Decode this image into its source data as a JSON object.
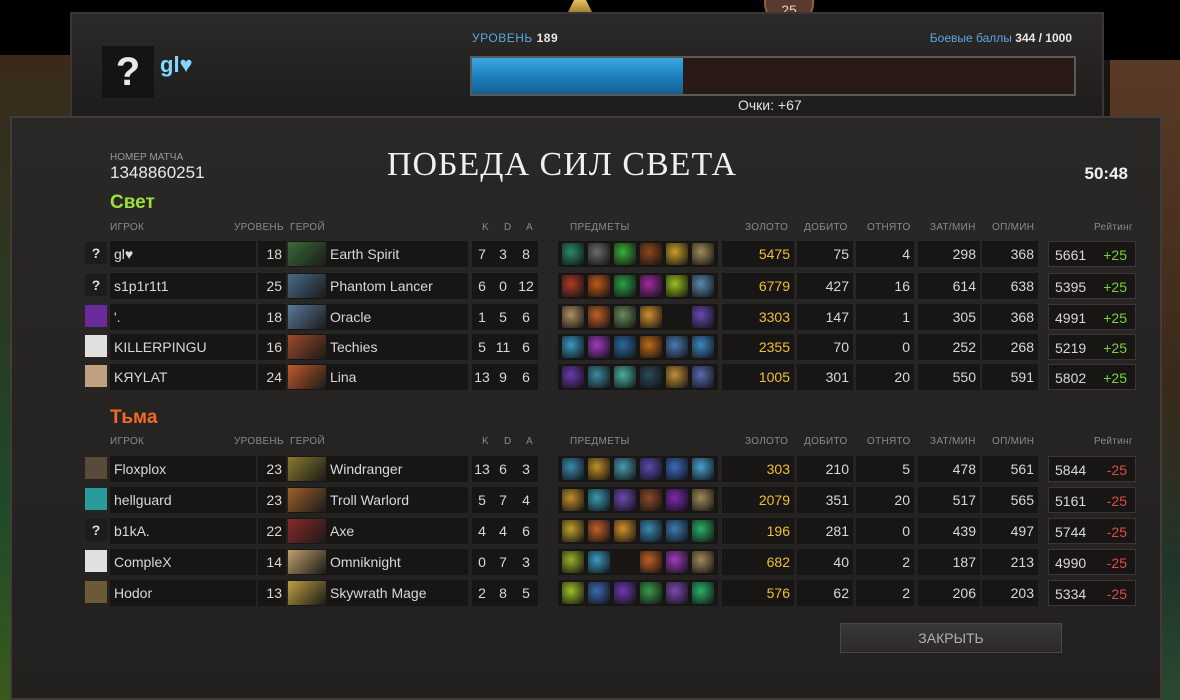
{
  "top_badge": "25",
  "level_panel": {
    "avatar_glyph": "?",
    "player_name": "gl♥",
    "level_label": "УРОВЕНЬ",
    "level_value": "189",
    "battle_label": "Боевые баллы",
    "battle_value": "344 / 1000",
    "xp_progress": 0.35,
    "points": "Очки: +67"
  },
  "match": {
    "label": "НОМЕР МАТЧА",
    "id": "1348860251",
    "title": "ПОБЕДА СИЛ СВЕТА",
    "duration": "50:48"
  },
  "headers": {
    "player": "ИГРОК",
    "level": "УРОВЕНЬ",
    "hero": "ГЕРОЙ",
    "k": "K",
    "d": "D",
    "a": "A",
    "items": "ПРЕДМЕТЫ",
    "gold": "ЗОЛОТО",
    "last_hits": "ДОБИТО",
    "denies": "ОТНЯТО",
    "gpm": "ЗАТ/МИН",
    "xpm": "ОП/МИН",
    "rating": "Рейтинг"
  },
  "radiant": {
    "name": "Свет",
    "players": [
      {
        "avatar": "?",
        "avatar_color": "#1c1c1c",
        "name": "gl♥",
        "level": "18",
        "hero": "Earth Spirit",
        "hero_color": "#3a6a3a",
        "k": "7",
        "d": "3",
        "a": "8",
        "items": [
          "#2a8a6a",
          "#6a6a6a",
          "#3ab03a",
          "#8a4a1a",
          "#c8a02a",
          "#a08a5a"
        ],
        "gold": "5475",
        "lh": "75",
        "dn": "4",
        "gpm": "298",
        "xpm": "368",
        "rating": "5661",
        "delta": "+25"
      },
      {
        "avatar": "?",
        "avatar_color": "#1c1c1c",
        "name": "s1p1r1t1",
        "level": "25",
        "hero": "Phantom Lancer",
        "hero_color": "#4a6a8a",
        "k": "6",
        "d": "0",
        "a": "12",
        "items": [
          "#b03a2a",
          "#c05a1a",
          "#2aa04a",
          "#a02aa0",
          "#9ac020",
          "#5a8ab0"
        ],
        "gold": "6779",
        "lh": "427",
        "dn": "16",
        "gpm": "614",
        "xpm": "638",
        "rating": "5395",
        "delta": "+25"
      },
      {
        "avatar": "",
        "avatar_color": "#6a2a9a",
        "name": "'.",
        "level": "18",
        "hero": "Oracle",
        "hero_color": "#5a7a9a",
        "k": "1",
        "d": "5",
        "a": "6",
        "items": [
          "#b09060",
          "#c0602a",
          "#6a8a5a",
          "#d09030",
          "",
          "#6a4ab0"
        ],
        "gold": "3303",
        "lh": "147",
        "dn": "1",
        "gpm": "305",
        "xpm": "368",
        "rating": "4991",
        "delta": "+25"
      },
      {
        "avatar": "",
        "avatar_color": "#e0e0e0",
        "name": "KILLERPINGU",
        "level": "16",
        "hero": "Techies",
        "hero_color": "#a04a2a",
        "k": "5",
        "d": "11",
        "a": "6",
        "items": [
          "#3a9ac0",
          "#a03ac0",
          "#2a6aa0",
          "#c06a1a",
          "#4a7ab0",
          "#3a8ac0"
        ],
        "gold": "2355",
        "lh": "70",
        "dn": "0",
        "gpm": "252",
        "xpm": "268",
        "rating": "5219",
        "delta": "+25"
      },
      {
        "avatar": "",
        "avatar_color": "#c0a080",
        "name": "KЯYLAT",
        "level": "24",
        "hero": "Lina",
        "hero_color": "#c05a2a",
        "k": "13",
        "d": "9",
        "a": "6",
        "items": [
          "#6a3ab0",
          "#3a8aa0",
          "#4ab0a0",
          "#2a4a5a",
          "#c0903a",
          "#5a6ab0"
        ],
        "gold": "1005",
        "lh": "301",
        "dn": "20",
        "gpm": "550",
        "xpm": "591",
        "rating": "5802",
        "delta": "+25"
      }
    ]
  },
  "dire": {
    "name": "Тьма",
    "players": [
      {
        "avatar": "",
        "avatar_color": "#5a4a3a",
        "name": "Floxplox",
        "level": "23",
        "hero": "Windranger",
        "hero_color": "#8a7a2a",
        "k": "13",
        "d": "6",
        "a": "3",
        "items": [
          "#3a8ab0",
          "#c0902a",
          "#4a9ab0",
          "#5a4ab0",
          "#3a6ac0",
          "#4aa0d0"
        ],
        "gold": "303",
        "lh": "210",
        "dn": "5",
        "gpm": "478",
        "xpm": "561",
        "rating": "5844",
        "delta": "-25"
      },
      {
        "avatar": "",
        "avatar_color": "#2a9a9a",
        "name": "hellguard",
        "level": "23",
        "hero": "Troll Warlord",
        "hero_color": "#a0602a",
        "k": "5",
        "d": "7",
        "a": "4",
        "items": [
          "#c0902a",
          "#3a9ab0",
          "#6a4ab0",
          "#8a4a2a",
          "#7a2ab0",
          "#a08a5a"
        ],
        "gold": "2079",
        "lh": "351",
        "dn": "20",
        "gpm": "517",
        "xpm": "565",
        "rating": "5161",
        "delta": "-25"
      },
      {
        "avatar": "?",
        "avatar_color": "#1c1c1c",
        "name": "b1kA.",
        "level": "22",
        "hero": "Axe",
        "hero_color": "#8a2a2a",
        "k": "4",
        "d": "4",
        "a": "6",
        "items": [
          "#c0a02a",
          "#c0602a",
          "#d0902a",
          "#3a8ab0",
          "#3a7ab0",
          "#2ab06a"
        ],
        "gold": "196",
        "lh": "281",
        "dn": "0",
        "gpm": "439",
        "xpm": "497",
        "rating": "5744",
        "delta": "-25"
      },
      {
        "avatar": "",
        "avatar_color": "#e0e0e0",
        "name": "CompleX",
        "level": "14",
        "hero": "Omniknight",
        "hero_color": "#c0a06a",
        "k": "0",
        "d": "7",
        "a": "3",
        "items": [
          "#9ab02a",
          "#3a9ac0",
          "",
          "#c0602a",
          "#a03ac0",
          "#a08a5a"
        ],
        "gold": "682",
        "lh": "40",
        "dn": "2",
        "gpm": "187",
        "xpm": "213",
        "rating": "4990",
        "delta": "-25"
      },
      {
        "avatar": "",
        "avatar_color": "#6a5a3a",
        "name": "Hodor",
        "level": "13",
        "hero": "Skywrath Mage",
        "hero_color": "#c0a040",
        "k": "2",
        "d": "8",
        "a": "5",
        "items": [
          "#a0c02a",
          "#3a6ab0",
          "#6a3ab0",
          "#3a9a4a",
          "#7a4ab0",
          "#2ab06a"
        ],
        "gold": "576",
        "lh": "62",
        "dn": "2",
        "gpm": "206",
        "xpm": "203",
        "rating": "5334",
        "delta": "-25"
      }
    ]
  },
  "close_button": "ЗАКРЫТЬ"
}
